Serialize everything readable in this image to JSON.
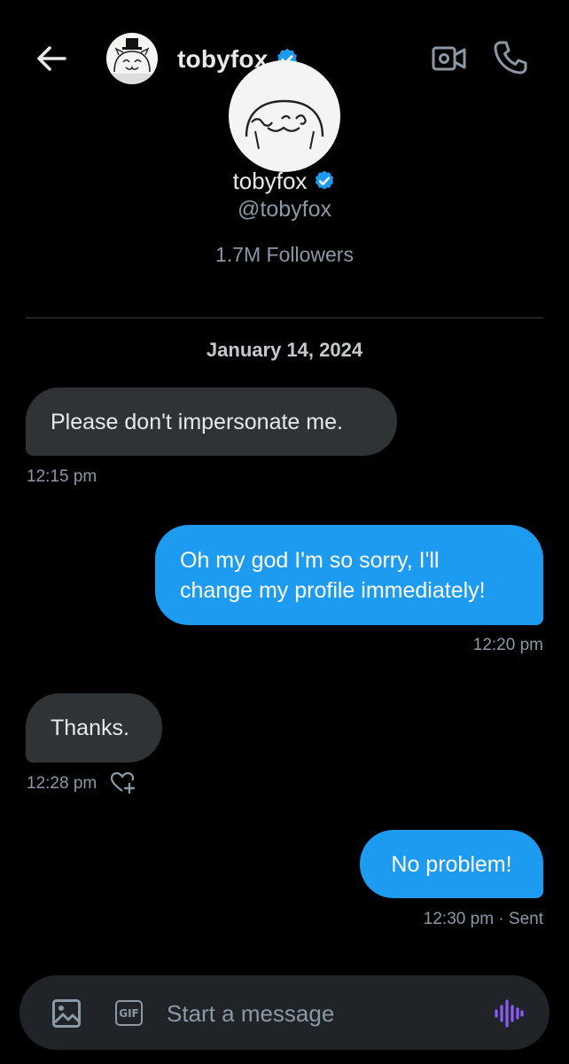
{
  "header": {
    "name": "tobyfox"
  },
  "profile": {
    "name": "tobyfox",
    "handle": "@tobyfox",
    "followers": "1.7M Followers"
  },
  "conversation": {
    "date": "January 14, 2024",
    "messages": [
      {
        "direction": "incoming",
        "text": "Please don't impersonate me.",
        "time": "12:15 pm"
      },
      {
        "direction": "outgoing",
        "text_line1": "Oh my god I'm so sorry, I'll",
        "text_line2": "change my profile immediately!",
        "time": "12:20 pm"
      },
      {
        "direction": "incoming",
        "text": "Thanks.",
        "time": "12:28 pm"
      },
      {
        "direction": "outgoing",
        "text": "No problem!",
        "time": "12:30 pm · Sent"
      }
    ]
  },
  "composer": {
    "gif_label": "GIF",
    "placeholder": "Start a message"
  },
  "colors": {
    "background": "#000000",
    "incoming_bubble": "#2f3336",
    "outgoing_bubble": "#1d9bf0",
    "verified_badge": "#1d9bf0",
    "voice_icon": "#8b5cf6",
    "secondary_text": "#8b98a5"
  },
  "icons": {
    "back": "arrow-left-icon",
    "verified": "verified-badge-icon",
    "video": "video-camera-icon",
    "phone": "phone-icon",
    "react": "heart-plus-icon",
    "image": "image-icon",
    "voice": "voice-wave-icon"
  }
}
